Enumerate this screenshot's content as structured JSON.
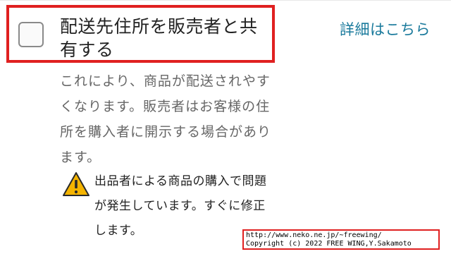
{
  "share_address": {
    "label": "配送先住所を販売者と共有する",
    "checked": false,
    "details_link": "詳細はこちら",
    "description": "これにより、商品が配送されやすくなります。販売者はお客様の住所を購入者に開示する場合があります。"
  },
  "warning": {
    "icon": "warning-triangle-icon",
    "text": "出品者による商品の購入で問題が発生しています。すぐに修正します。"
  },
  "credit": {
    "line1": "http://www.neko.ne.jp/~freewing/",
    "line2": "Copyright (c) 2022 FREE WING,Y.Sakamoto"
  },
  "colors": {
    "highlight": "#e02020",
    "link": "#1a7a9c",
    "warning": "#f5b400"
  }
}
